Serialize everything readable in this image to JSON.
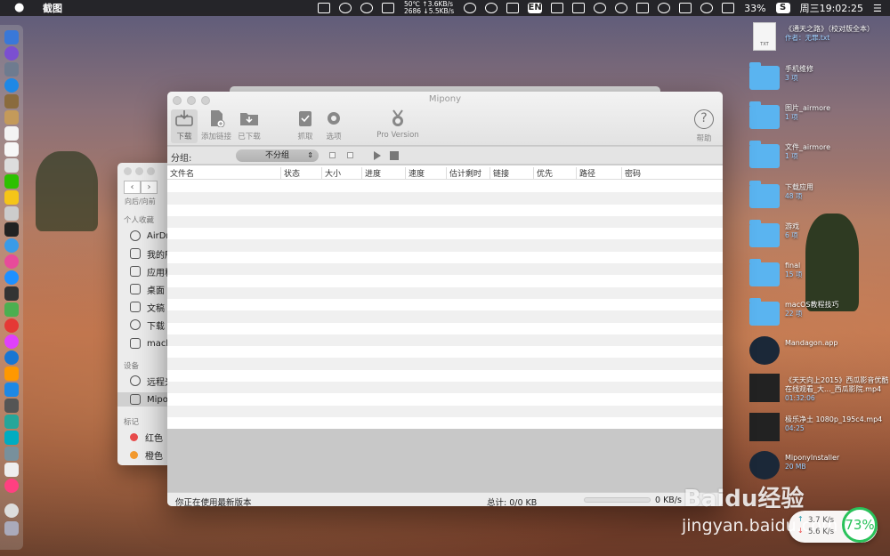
{
  "menubar": {
    "app_name": "截图",
    "net_up": "50℃ ↑3.6KB/s",
    "net_down": "2686 ↓5.5KB/s",
    "input_method": "EN",
    "battery": "33%",
    "clock": "周三19:02:25"
  },
  "desktop": [
    {
      "name": "《通天之路》（校对版全本）",
      "sub": "作者：无罪.txt",
      "kind": "doc",
      "badge": "TXT"
    },
    {
      "name": "手机维修",
      "sub": "3 项",
      "kind": "folder"
    },
    {
      "name": "图片_airmore",
      "sub": "1 项",
      "kind": "folder"
    },
    {
      "name": "文件_airmore",
      "sub": "1 项",
      "kind": "folder"
    },
    {
      "name": "下载应用",
      "sub": "48 项",
      "kind": "folder"
    },
    {
      "name": "游戏",
      "sub": "6 项",
      "kind": "folder"
    },
    {
      "name": "final",
      "sub": "15 项",
      "kind": "folder"
    },
    {
      "name": "macOS教程技巧",
      "sub": "22 项",
      "kind": "folder"
    },
    {
      "name": "Mandagon.app",
      "sub": "",
      "kind": "app"
    },
    {
      "name": "《天天向上2015》西瓜影音优酷在线观看_大..._西瓜影院.mp4",
      "sub": "01:32:06",
      "kind": "video"
    },
    {
      "name": "极乐净土 1080p_195c4.mp4",
      "sub": "04:25",
      "kind": "video"
    },
    {
      "name": "MiponyInstaller",
      "sub": "20 MB",
      "kind": "app"
    }
  ],
  "finder": {
    "nav_label": "向后/向前",
    "section_favorites": "个人收藏",
    "favorites": [
      "AirDr",
      "我的所",
      "应用程",
      "桌面",
      "文稿",
      "下载",
      "macb"
    ],
    "section_devices": "设备",
    "devices": [
      "远程光",
      "Mipo"
    ],
    "section_tags": "标记",
    "tags": [
      {
        "label": "红色",
        "color": "#e84b4b"
      },
      {
        "label": "橙色",
        "color": "#f39a2e"
      }
    ]
  },
  "mipony": {
    "title": "Mipony",
    "toolbar": {
      "download": "下载",
      "add_link": "添加链接",
      "downloaded": "已下载",
      "grab": "抓取",
      "options": "选项",
      "pro": "Pro Version",
      "help": "帮助"
    },
    "filter": {
      "label": "分组:",
      "selected": "不分组"
    },
    "columns": [
      "文件名",
      "状态",
      "大小",
      "进度",
      "速度",
      "估计剩时",
      "链接",
      "优先",
      "路径",
      "密码"
    ],
    "status": {
      "message": "你正在使用最新版本",
      "total": "总计: 0/0 KB",
      "speed": "0 KB/s"
    }
  },
  "network_widget": {
    "up": "3.7 K/s",
    "down": "5.6 K/s",
    "percent": "73%"
  },
  "watermark": {
    "line1": "Baidu经验",
    "line2": "jingyan.baidu.com"
  }
}
